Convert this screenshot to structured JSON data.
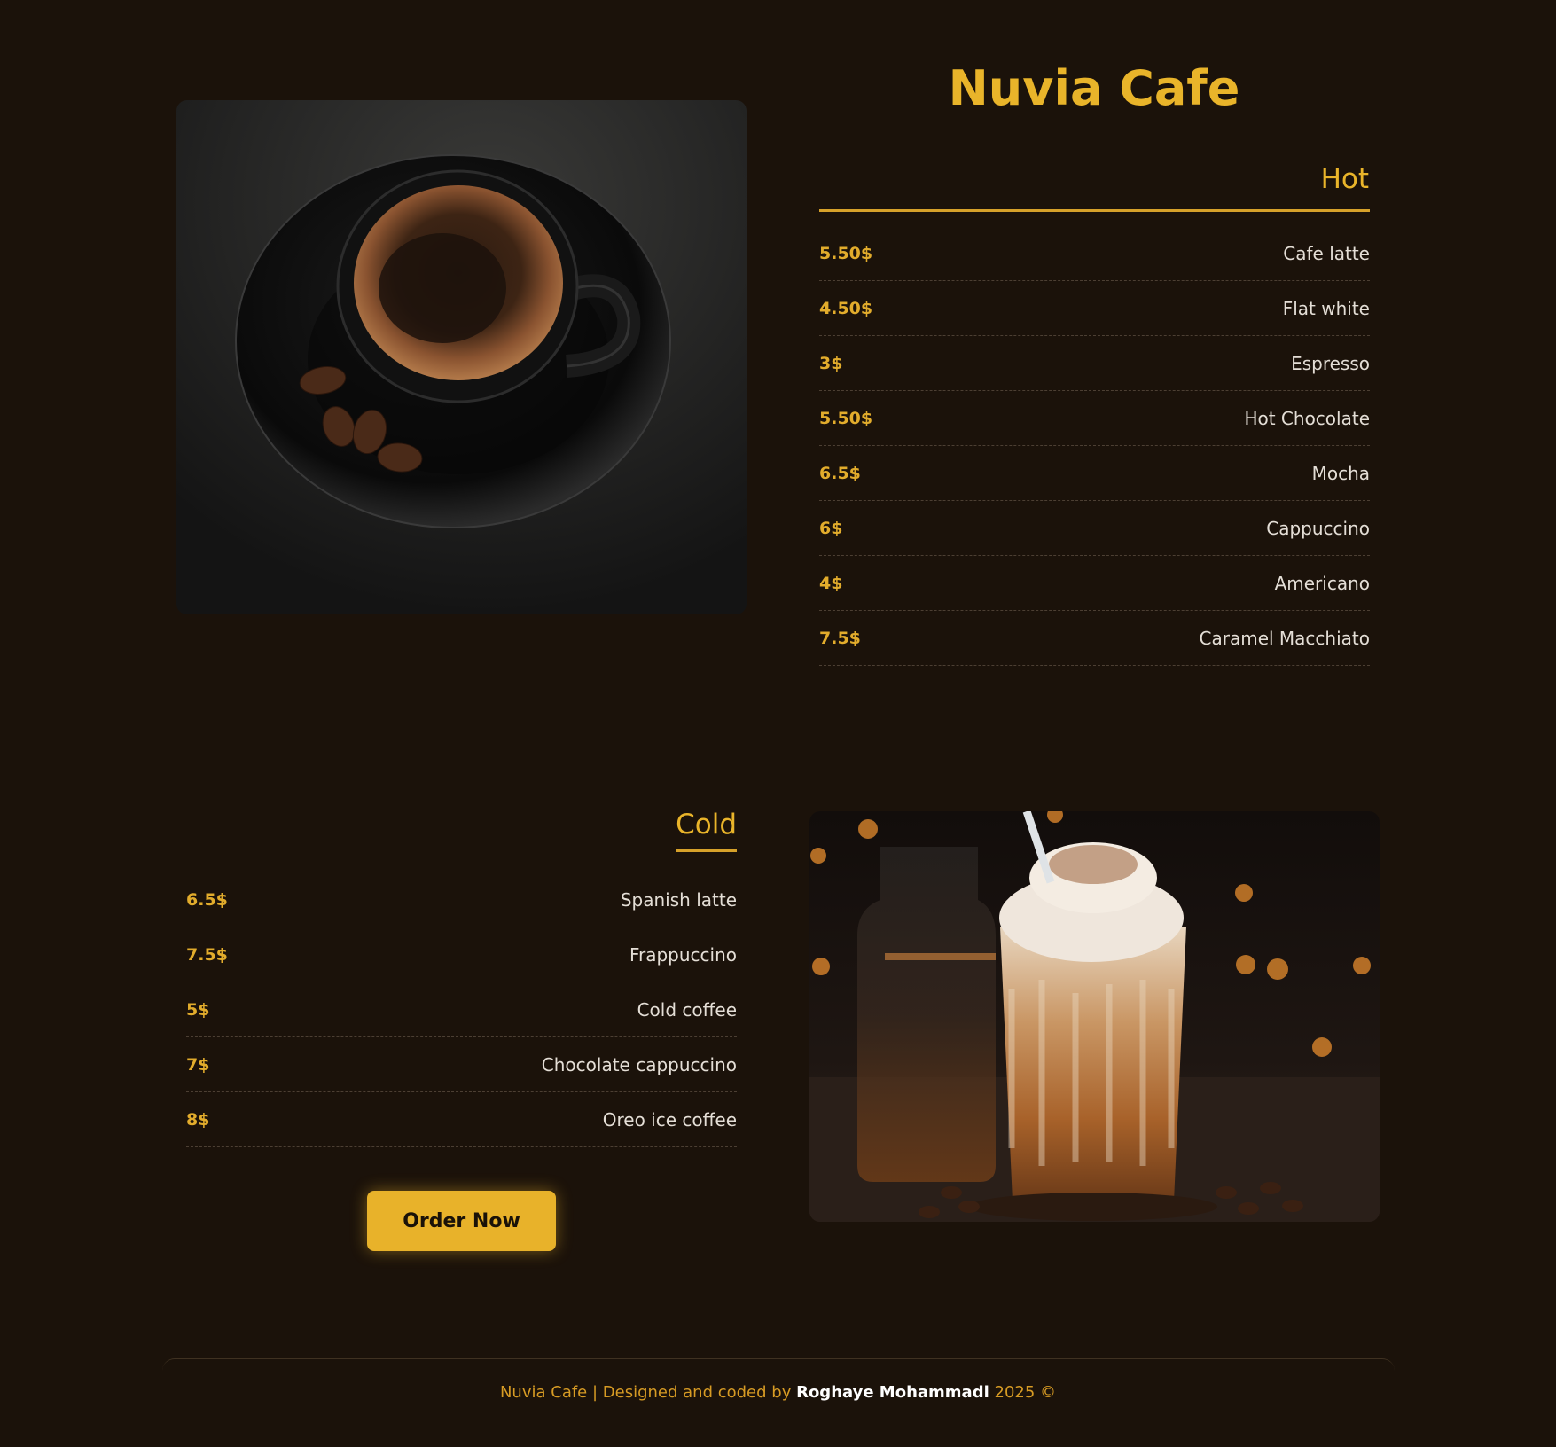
{
  "title": "Nuvia Cafe",
  "hot": {
    "heading": "Hot",
    "items": [
      {
        "price": "5.50$",
        "name": "Cafe latte"
      },
      {
        "price": "4.50$",
        "name": "Flat white"
      },
      {
        "price": "3$",
        "name": "Espresso"
      },
      {
        "price": "5.50$",
        "name": "Hot Chocolate"
      },
      {
        "price": "6.5$",
        "name": "Mocha"
      },
      {
        "price": "6$",
        "name": "Cappuccino"
      },
      {
        "price": "4$",
        "name": "Americano"
      },
      {
        "price": "7.5$",
        "name": "Caramel Macchiato"
      }
    ]
  },
  "cold": {
    "heading": "Cold",
    "items": [
      {
        "price": "6.5$",
        "name": "Spanish latte"
      },
      {
        "price": "7.5$",
        "name": "Frappuccino"
      },
      {
        "price": "5$",
        "name": "Cold coffee"
      },
      {
        "price": "7$",
        "name": "Chocolate cappuccino"
      },
      {
        "price": "8$",
        "name": "Oreo ice coffee"
      }
    ]
  },
  "order_button": "Order Now",
  "footer": {
    "prefix": "Nuvia Cafe | Designed and coded by ",
    "author": "Roghaye Mohammadi",
    "suffix": " 2025 ©"
  },
  "colors": {
    "background": "#1b120a",
    "accent": "#e9b42a",
    "text": "#e4ded6"
  },
  "images": {
    "hot": "black-coffee-cup-icon",
    "cold": "iced-coffee-glass-icon"
  }
}
